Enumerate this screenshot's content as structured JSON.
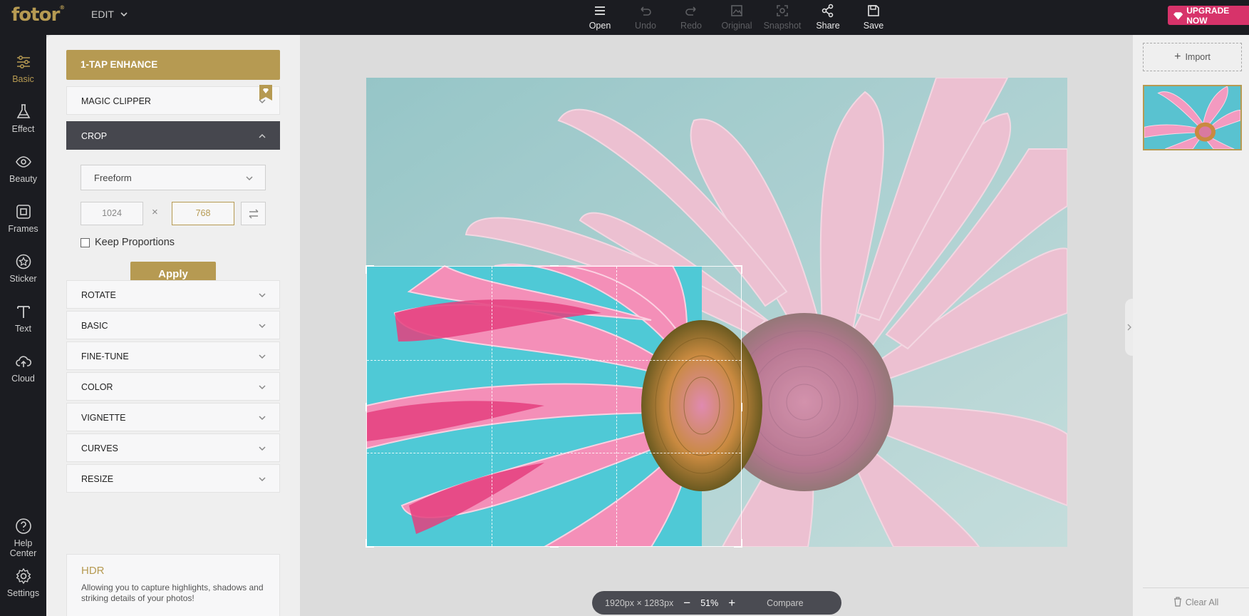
{
  "app": {
    "logo": "fotor",
    "edit_menu": "EDIT",
    "upgrade": "UPGRADE NOW"
  },
  "toolbar": [
    {
      "label": "Open",
      "icon": "menu-icon",
      "enabled": true
    },
    {
      "label": "Undo",
      "icon": "undo-icon",
      "enabled": false
    },
    {
      "label": "Redo",
      "icon": "redo-icon",
      "enabled": false
    },
    {
      "label": "Original",
      "icon": "image-icon",
      "enabled": false
    },
    {
      "label": "Snapshot",
      "icon": "snapshot-icon",
      "enabled": false
    },
    {
      "label": "Share",
      "icon": "share-icon",
      "enabled": true
    },
    {
      "label": "Save",
      "icon": "save-icon",
      "enabled": true
    }
  ],
  "rail": [
    {
      "label": "Basic",
      "icon": "sliders-icon",
      "active": true
    },
    {
      "label": "Effect",
      "icon": "flask-icon"
    },
    {
      "label": "Beauty",
      "icon": "eye-icon"
    },
    {
      "label": "Frames",
      "icon": "frame-icon"
    },
    {
      "label": "Sticker",
      "icon": "star-circle-icon"
    },
    {
      "label": "Text",
      "icon": "text-icon"
    },
    {
      "label": "Cloud",
      "icon": "cloud-upload-icon"
    },
    {
      "label": "Help Center",
      "icon": "help-icon"
    },
    {
      "label": "Settings",
      "icon": "gear-icon"
    }
  ],
  "panel": {
    "enhance": "1-TAP ENHANCE",
    "magic_clipper": "MAGIC CLIPPER",
    "crop": "CROP",
    "crop_mode": "Freeform",
    "width": "1024",
    "height": "768",
    "times": "×",
    "keep_proportions": "Keep Proportions",
    "apply": "Apply",
    "sections": [
      "ROTATE",
      "BASIC",
      "FINE-TUNE",
      "COLOR",
      "VIGNETTE",
      "CURVES",
      "RESIZE"
    ],
    "hdr_title": "HDR",
    "hdr_desc": "Allowing you to capture highlights, shadows and striking details of your photos!"
  },
  "canvas": {
    "image_size": "1920px × 1283px",
    "zoom": "51%",
    "minus": "−",
    "plus": "+",
    "compare": "Compare"
  },
  "right": {
    "import": "Import",
    "clear_all": "Clear All"
  },
  "colors": {
    "accent": "#b69a52",
    "upgrade": "#d7336a",
    "dark": "#1b1c21"
  }
}
